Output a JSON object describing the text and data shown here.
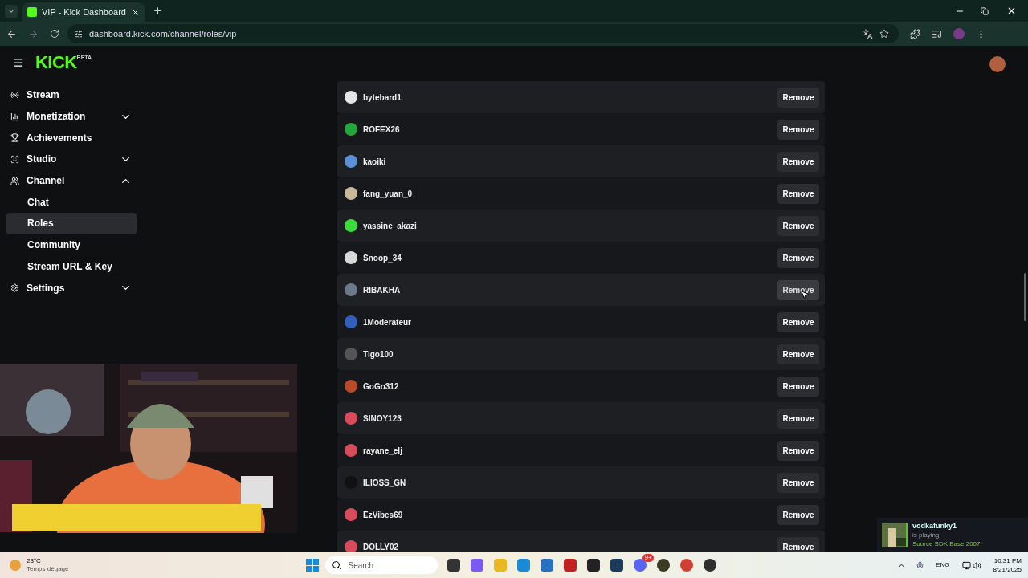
{
  "browser": {
    "tab_title": "VIP - Kick Dashboard",
    "url": "dashboard.kick.com/channel/roles/vip"
  },
  "logo": {
    "text": "KICK",
    "badge": "BETA"
  },
  "nav": [
    {
      "label": "Stream"
    },
    {
      "label": "Monetization",
      "expanded": false
    },
    {
      "label": "Achievements"
    },
    {
      "label": "Studio",
      "expanded": false
    },
    {
      "label": "Channel",
      "expanded": true,
      "children": [
        {
          "label": "Chat",
          "selected": false
        },
        {
          "label": "Roles",
          "selected": true
        },
        {
          "label": "Community",
          "selected": false
        },
        {
          "label": "Stream URL & Key",
          "selected": false
        }
      ]
    },
    {
      "label": "Settings",
      "expanded": false
    }
  ],
  "vips": [
    {
      "name": "bytebard1",
      "color": "#e5e5e5",
      "hovered": false,
      "button": "Remove"
    },
    {
      "name": "ROFEX26",
      "color": "#22a83a",
      "hovered": false,
      "button": "Remove"
    },
    {
      "name": "kaoiki",
      "color": "#5b8fd6",
      "hovered": false,
      "button": "Remove"
    },
    {
      "name": "fang_yuan_0",
      "color": "#c9b79a",
      "hovered": false,
      "button": "Remove"
    },
    {
      "name": "yassine_akazi",
      "color": "#3ddc3d",
      "hovered": false,
      "button": "Remove"
    },
    {
      "name": "Snoop_34",
      "color": "#d8d8d8",
      "hovered": false,
      "button": "Remove"
    },
    {
      "name": "RIBAKHA",
      "color": "#6a7a8a",
      "hovered": true,
      "button": "Remove"
    },
    {
      "name": "1Moderateur",
      "color": "#2f5fbf",
      "hovered": false,
      "button": "Remove"
    },
    {
      "name": "Tigo100",
      "color": "#555555",
      "hovered": false,
      "button": "Remove"
    },
    {
      "name": "GoGo312",
      "color": "#b84a2a",
      "hovered": false,
      "button": "Remove"
    },
    {
      "name": "SINOY123",
      "color": "#d94a5a",
      "hovered": false,
      "button": "Remove"
    },
    {
      "name": "rayane_elj",
      "color": "#d94a5a",
      "hovered": false,
      "button": "Remove"
    },
    {
      "name": "ILIOSS_GN",
      "color": "#111111",
      "hovered": false,
      "button": "Remove"
    },
    {
      "name": "EzVibes69",
      "color": "#d94a5a",
      "hovered": false,
      "button": "Remove"
    },
    {
      "name": "DOLLY02",
      "color": "#d94a5a",
      "hovered": false,
      "button": "Remove"
    }
  ],
  "notification": {
    "user": "vodkafunky1",
    "status": "is playing",
    "game": "Source SDK Base 2007"
  },
  "taskbar": {
    "temperature": "23°C",
    "weather": "Temps dégagé",
    "search_placeholder": "Search",
    "discord_badge": "9+",
    "language": "ENG",
    "time": "10:31 PM",
    "date": "8/21/2025"
  }
}
